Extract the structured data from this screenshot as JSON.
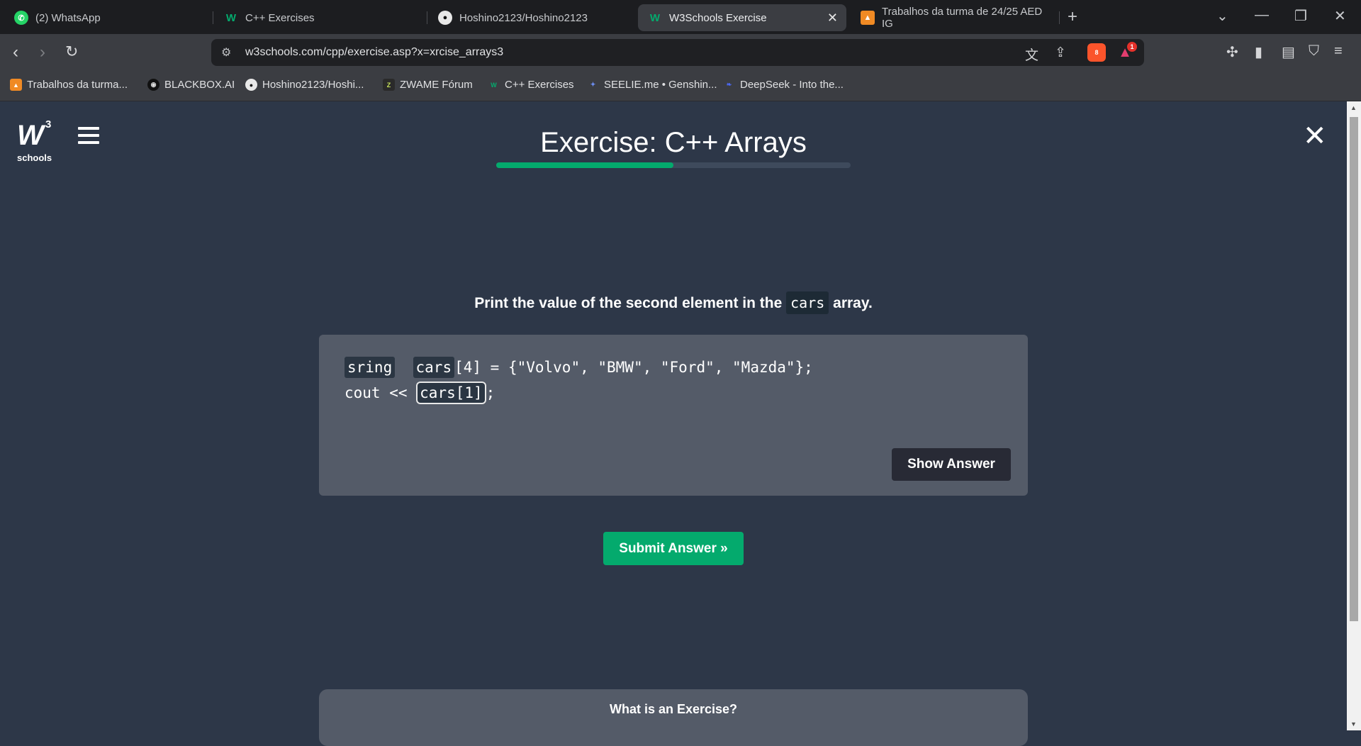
{
  "browser": {
    "tabs": [
      {
        "label": "(2) WhatsApp",
        "icon": "whatsapp-icon"
      },
      {
        "label": "C++ Exercises",
        "icon": "w3schools-icon"
      },
      {
        "label": "Hoshino2123/Hoshino2123",
        "icon": "github-icon"
      },
      {
        "label": "W3Schools Exercise",
        "icon": "w3schools-icon",
        "active": true
      },
      {
        "label": "Trabalhos da turma de 24/25 AED IG",
        "icon": "classroom-icon"
      }
    ],
    "new_tab": "+",
    "tab_close": "✕",
    "url": "w3schools.com/cpp/exercise.asp?x=xrcise_arrays3",
    "brave_badge_count": "8",
    "alert_badge_count": "1",
    "bookmarks": [
      {
        "label": "Trabalhos da turma...",
        "icon": "classroom-icon"
      },
      {
        "label": "BLACKBOX.AI",
        "icon": "blackbox-icon"
      },
      {
        "label": "Hoshino2123/Hoshi...",
        "icon": "github-icon"
      },
      {
        "label": "ZWAME Fórum",
        "icon": "zwame-icon"
      },
      {
        "label": "C++ Exercises",
        "icon": "w3schools-icon"
      },
      {
        "label": "SEELIE.me • Genshin...",
        "icon": "seelie-icon"
      },
      {
        "label": "DeepSeek - Into the...",
        "icon": "deepseek-icon"
      }
    ]
  },
  "page": {
    "logo_sup": "3",
    "logo_text": "schools",
    "title": "Exercise: C++ Arrays",
    "progress": 0.5,
    "question_before": "Print the value of the second element in the",
    "question_code": "cars",
    "question_after": "array.",
    "code": {
      "line1_type": "sring",
      "line1_var": "cars",
      "line1_rest": "[4] = {\"Volvo\", \"BMW\", \"Ford\", \"Mazda\"};",
      "line2_prefix": "cout << ",
      "line2_answer": "cars[1]",
      "line2_suffix": ";"
    },
    "show_answer_label": "Show Answer",
    "submit_label": "Submit Answer »",
    "info_title": "What is an Exercise?"
  }
}
